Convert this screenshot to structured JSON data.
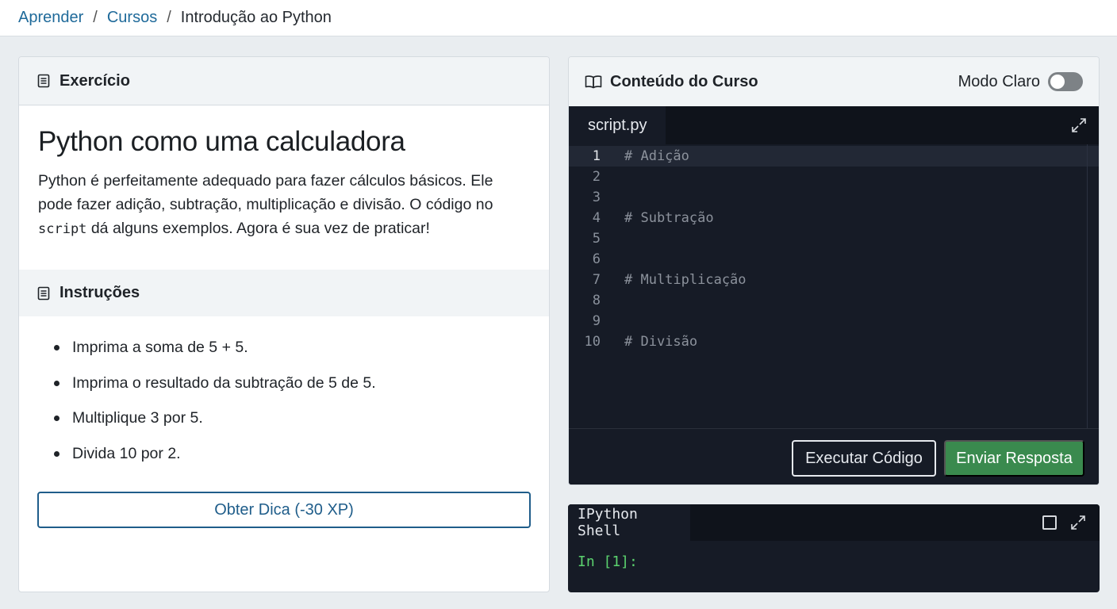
{
  "breadcrumb": {
    "items": [
      "Aprender",
      "Cursos"
    ],
    "separator": "/",
    "current": "Introdução ao Python"
  },
  "exercise": {
    "header": "Exercício",
    "title": "Python como uma calculadora",
    "desc_part1": "Python é perfeitamente adequado para fazer cálculos básicos. Ele pode fazer adição, subtração, multiplicação e divisão. O código no ",
    "desc_code": "script",
    "desc_part2": " dá alguns exemplos. Agora é sua vez de praticar!"
  },
  "instructions": {
    "header": "Instruções",
    "items": [
      "Imprima a soma de 5 + 5.",
      "Imprima o resultado da subtração de 5 de 5.",
      "Multiplique 3 por 5.",
      "Divida 10 por 2."
    ],
    "hint_button": "Obter Dica (-30 XP)"
  },
  "course": {
    "header": "Conteúdo do Curso",
    "mode_label": "Modo Claro",
    "mode_on": false
  },
  "editor": {
    "tab": "script.py",
    "lines": [
      {
        "n": "1",
        "text": "# Adição"
      },
      {
        "n": "2",
        "text": ""
      },
      {
        "n": "3",
        "text": ""
      },
      {
        "n": "4",
        "text": "# Subtração"
      },
      {
        "n": "5",
        "text": ""
      },
      {
        "n": "6",
        "text": ""
      },
      {
        "n": "7",
        "text": "# Multiplicação"
      },
      {
        "n": "8",
        "text": ""
      },
      {
        "n": "9",
        "text": ""
      },
      {
        "n": "10",
        "text": "# Divisão"
      }
    ],
    "run_button": "Executar Código",
    "submit_button": "Enviar Resposta"
  },
  "shell": {
    "tab": "IPython Shell",
    "prompt": "In [1]:"
  },
  "colors": {
    "link": "#1f6a9a",
    "submit": "#3a8a4e",
    "prompt": "#5bd16e",
    "editor_bg": "#161b26"
  }
}
